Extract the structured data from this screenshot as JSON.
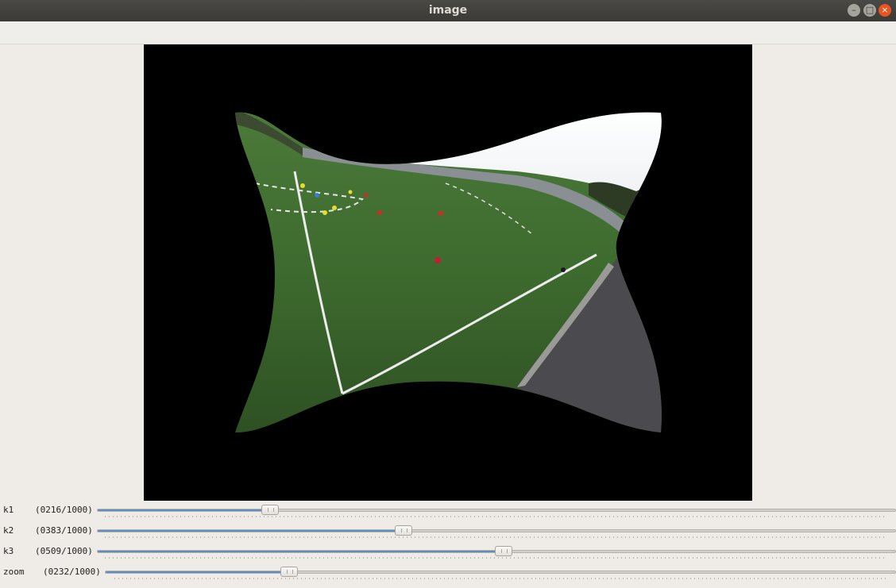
{
  "window": {
    "title": "image"
  },
  "window_controls": {
    "minimize": "–",
    "maximize": "□",
    "close": "×"
  },
  "trackbars": [
    {
      "name": "k1",
      "readout": "(0216/1000)",
      "value": 216,
      "max": 1000
    },
    {
      "name": "k2",
      "readout": "(0383/1000)",
      "value": 383,
      "max": 1000
    },
    {
      "name": "k3",
      "readout": "(0509/1000)",
      "value": 509,
      "max": 1000
    },
    {
      "name": "zoom",
      "readout": "(0232/1000)",
      "value": 232,
      "max": 1000
    }
  ],
  "colors": {
    "titlebar": "#3b3a37",
    "close_button": "#e95420",
    "slider_fill": "#5a8ec7",
    "window_bg": "#efebe7"
  }
}
